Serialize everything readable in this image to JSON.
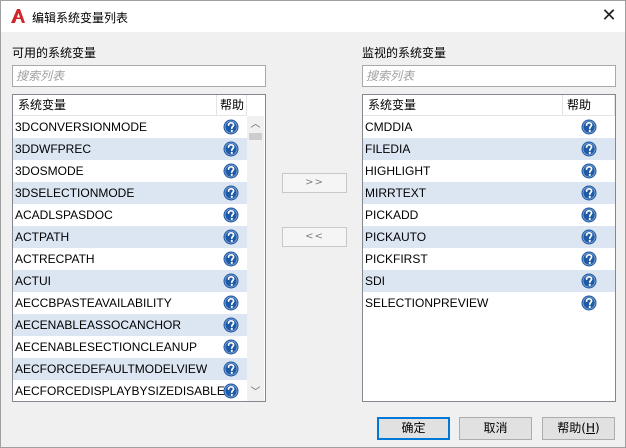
{
  "window": {
    "title": "编辑系统变量列表",
    "close_glyph": "✕"
  },
  "left": {
    "label": "可用的系统变量",
    "search_placeholder": "搜索列表",
    "columns": [
      "系统变量",
      "帮助"
    ],
    "items": [
      "3DCONVERSIONMODE",
      "3DDWFPREC",
      "3DOSMODE",
      "3DSELECTIONMODE",
      "ACADLSPASDOC",
      "ACTPATH",
      "ACTRECPATH",
      "ACTUI",
      "AECCBPASTEAVAILABILITY",
      "AECENABLEASSOCANCHOR",
      "AECENABLESECTIONCLEANUP",
      "AECFORCEDEFAULTMODELVIEW",
      "AECFORCEDISPLAYBYSIZEDISABLE"
    ]
  },
  "right": {
    "label": "监视的系统变量",
    "search_placeholder": "搜索列表",
    "columns": [
      "系统变量",
      "帮助"
    ],
    "items": [
      "CMDDIA",
      "FILEDIA",
      "HIGHLIGHT",
      "MIRRTEXT",
      "PICKADD",
      "PICKAUTO",
      "PICKFIRST",
      "SDI",
      "SELECTIONPREVIEW"
    ]
  },
  "middle": {
    "add_label": ">>",
    "remove_label": "<<"
  },
  "footer": {
    "ok_label": "确定",
    "cancel_label": "取消",
    "help_label": "帮助(",
    "help_accel": "H",
    "help_close": ")"
  },
  "colors": {
    "row_alt": "#dce6f2",
    "help_icon": "#1f5aa6",
    "app_icon": "#d0252b"
  },
  "icons": {
    "app": "autocad-a-icon",
    "help": "question-circle-icon"
  }
}
